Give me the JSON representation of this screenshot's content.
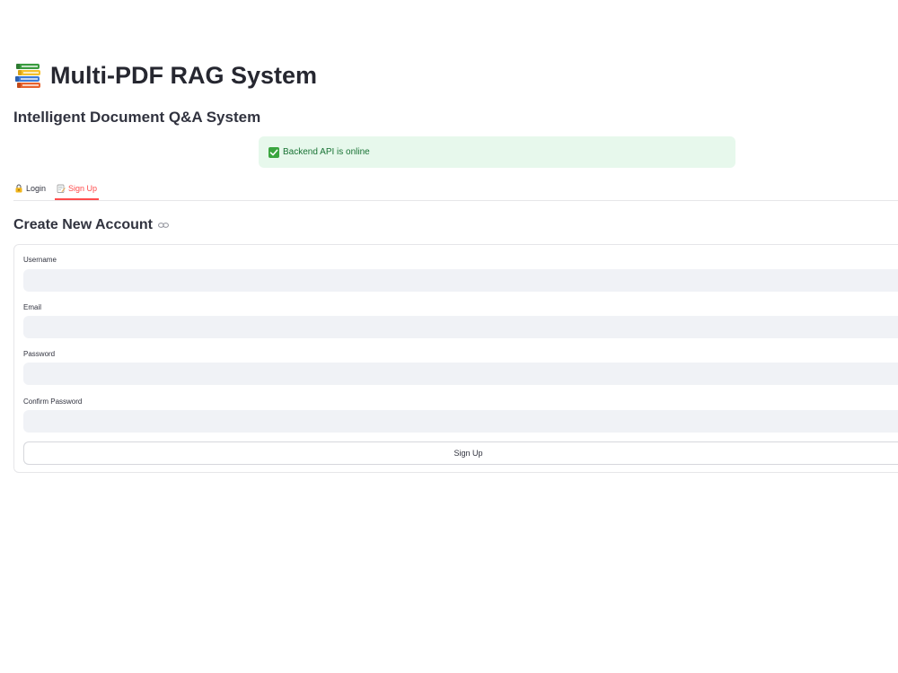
{
  "header": {
    "title": "Multi-PDF RAG System",
    "subtitle": "Intelligent Document Q&A System",
    "title_icon": "books-icon"
  },
  "status": {
    "message": "Backend API is online",
    "icon": "check-icon",
    "color": "#177233",
    "background": "#e7f8ec"
  },
  "tabs": [
    {
      "label": "Login",
      "icon": "lock-icon",
      "active": false
    },
    {
      "label": "Sign Up",
      "icon": "memo-icon",
      "active": true
    }
  ],
  "signup_form": {
    "heading": "Create New Account",
    "heading_icon": "link-icon",
    "fields": {
      "username": {
        "label": "Username",
        "value": ""
      },
      "email": {
        "label": "Email",
        "value": ""
      },
      "password": {
        "label": "Password",
        "value": ""
      },
      "confirm_password": {
        "label": "Confirm Password",
        "value": ""
      }
    },
    "submit_label": "Sign Up"
  },
  "colors": {
    "accent": "#ff4b4b",
    "input_background": "#f0f2f6",
    "border": "#e6e6e9"
  }
}
